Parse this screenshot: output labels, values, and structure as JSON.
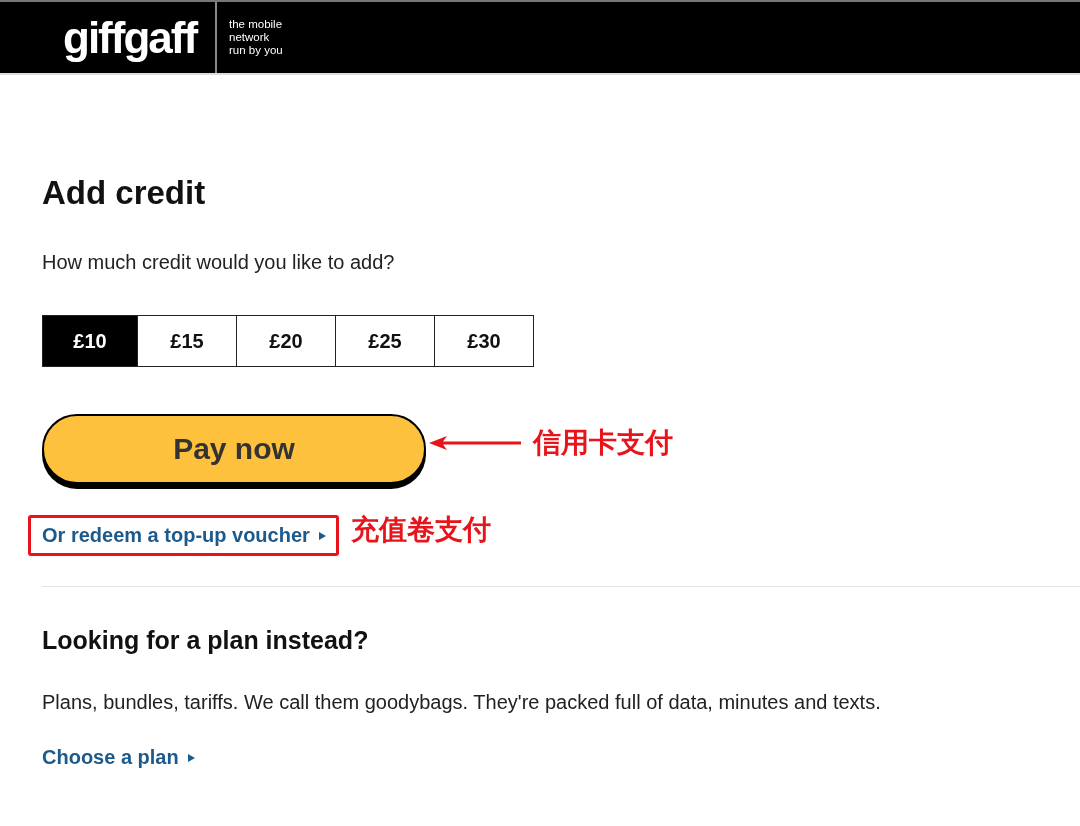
{
  "header": {
    "logo": "giffgaff",
    "tagline": [
      "the mobile",
      "network",
      "run by you"
    ]
  },
  "title": "Add credit",
  "question": "How much credit would you like to add?",
  "amounts": [
    {
      "label": "£10",
      "selected": true
    },
    {
      "label": "£15",
      "selected": false
    },
    {
      "label": "£20",
      "selected": false
    },
    {
      "label": "£25",
      "selected": false
    },
    {
      "label": "£30",
      "selected": false
    }
  ],
  "pay_button": "Pay now",
  "voucher_link": "Or redeem a top-up voucher",
  "annotations": {
    "pay_note": "信用卡支付",
    "voucher_note": "充值卷支付"
  },
  "plan_section": {
    "heading": "Looking for a plan instead?",
    "text": "Plans, bundles, tariffs. We call them goodybags. They're packed full of data, minutes and texts.",
    "link": "Choose a plan"
  }
}
